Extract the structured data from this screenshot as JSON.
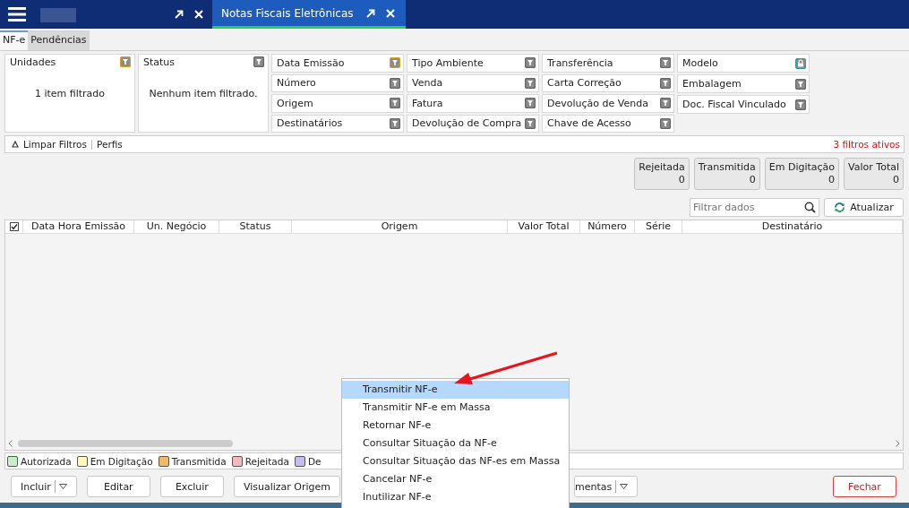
{
  "topbar": {
    "tabs": [
      {
        "selected": false
      },
      {
        "title": "Notas Fiscais Eletrônicas",
        "selected": true
      }
    ]
  },
  "subtabs": [
    {
      "label": "NF-e",
      "selected": true
    },
    {
      "label": "Pendências",
      "selected": false
    }
  ],
  "filter_panels": [
    {
      "title": "Unidades",
      "active": true,
      "summary": "1 item filtrado"
    },
    {
      "title": "Status",
      "active": false,
      "summary": "Nenhum item filtrado."
    }
  ],
  "filter_columns": [
    [
      {
        "label": "Data Emissão",
        "kind": "filter",
        "active": true
      },
      {
        "label": "Número",
        "kind": "filter",
        "active": false
      },
      {
        "label": "Origem",
        "kind": "filter",
        "active": false
      },
      {
        "label": "Destinatários",
        "kind": "filter",
        "active": false
      }
    ],
    [
      {
        "label": "Tipo Ambiente",
        "kind": "filter",
        "active": false
      },
      {
        "label": "Venda",
        "kind": "filter",
        "active": false
      },
      {
        "label": "Fatura",
        "kind": "filter",
        "active": false
      },
      {
        "label": "Devolução de Compra",
        "kind": "filter",
        "active": false
      }
    ],
    [
      {
        "label": "Transferência",
        "kind": "filter",
        "active": false
      },
      {
        "label": "Carta Correção",
        "kind": "filter",
        "active": false
      },
      {
        "label": "Devolução de Venda",
        "kind": "filter",
        "active": false
      },
      {
        "label": "Chave de Acesso",
        "kind": "filter",
        "active": false
      }
    ],
    [
      {
        "label": "Modelo",
        "kind": "lock",
        "active": true
      },
      {
        "label": "Embalagem",
        "kind": "filter",
        "active": false
      },
      {
        "label": "Doc. Fiscal Vinculado",
        "kind": "filter",
        "active": false
      }
    ]
  ],
  "filter_bar": {
    "clear": "Limpar Filtros",
    "profiles": "Perfis",
    "active_count": "3 filtros ativos"
  },
  "summary": [
    {
      "label": "Rejeitada",
      "value": "0"
    },
    {
      "label": "Transmitida",
      "value": "0"
    },
    {
      "label": "Em Digitação",
      "value": "0"
    },
    {
      "label": "Valor Total",
      "value": "0"
    }
  ],
  "search": {
    "placeholder": "Filtrar dados"
  },
  "refresh_button": "Atualizar",
  "table": {
    "select_all_checked": true,
    "columns": [
      "Data Hora Emissão",
      "Un. Negócio",
      "Status",
      "Origem",
      "Valor Total",
      "Número",
      "Série",
      "Destinatário"
    ]
  },
  "legend": [
    {
      "label": "Autorizada",
      "color": "#c8f0c8"
    },
    {
      "label": "Em Digitação",
      "color": "#fff6c0"
    },
    {
      "label": "Transmitida",
      "color": "#f3b865"
    },
    {
      "label": "Rejeitada",
      "color": "#f5b9bd"
    },
    {
      "label": "De",
      "color": "#c4bdf2"
    }
  ],
  "buttons": [
    {
      "label": "Incluir",
      "kind": "split"
    },
    {
      "label": "Editar",
      "kind": "plain"
    },
    {
      "label": "Excluir",
      "kind": "plain"
    },
    {
      "label": "Visualizar Origem",
      "kind": "plain"
    },
    {
      "label": "mentas",
      "kind": "split"
    }
  ],
  "close_button": "Fechar",
  "context_menu": [
    {
      "label": "Transmitir NF-e",
      "selected": true
    },
    {
      "label": "Transmitir NF-e em Massa",
      "selected": false
    },
    {
      "label": "Retornar NF-e",
      "selected": false
    },
    {
      "label": "Consultar Situação da NF-e",
      "selected": false
    },
    {
      "label": "Consultar Situação das NF-es em Massa",
      "selected": false
    },
    {
      "label": "Cancelar NF-e",
      "selected": false
    },
    {
      "label": "Inutilizar NF-e",
      "selected": false
    }
  ]
}
